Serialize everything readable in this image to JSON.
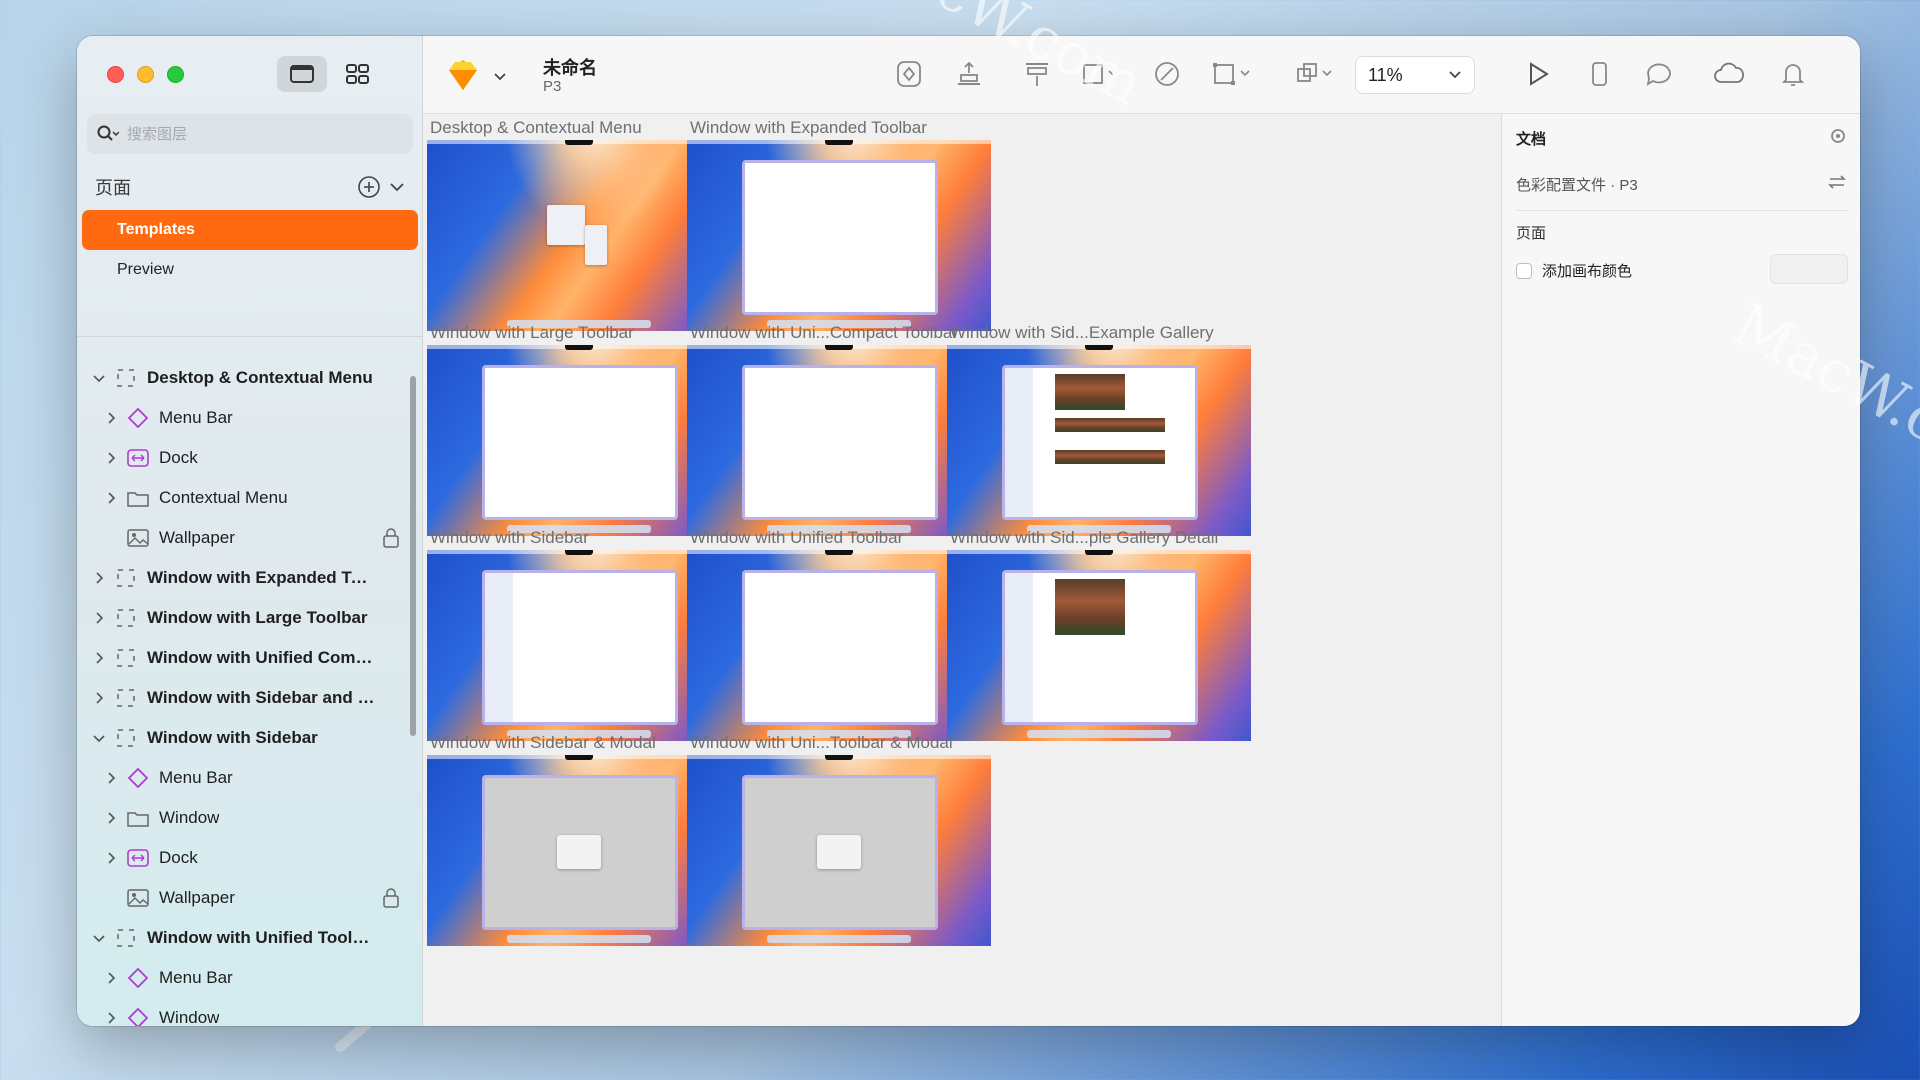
{
  "app": {
    "doc_title": "未命名",
    "doc_subtitle": "P3",
    "zoom": "11%",
    "accent_color": "#ff6a10"
  },
  "sidebar": {
    "search_placeholder": "搜索图层",
    "pages_title": "页面",
    "pages": [
      {
        "label": "Templates",
        "selected": true
      },
      {
        "label": "Preview",
        "selected": false
      }
    ],
    "layers": [
      {
        "label": "Desktop & Contextual Menu",
        "icon": "artboard-icon",
        "expanded": true,
        "level": 0
      },
      {
        "label": "Menu Bar",
        "icon": "symbol-icon",
        "level": 1
      },
      {
        "label": "Dock",
        "icon": "dock-icon",
        "level": 1
      },
      {
        "label": "Contextual Menu",
        "icon": "folder-icon",
        "level": 1
      },
      {
        "label": "Wallpaper",
        "icon": "image-icon",
        "level": 1,
        "locked": true
      },
      {
        "label": "Window with Expanded Tool...",
        "icon": "artboard-icon",
        "level": 0
      },
      {
        "label": "Window with Large Toolbar",
        "icon": "artboard-icon",
        "level": 0
      },
      {
        "label": "Window with Unified Compa...",
        "icon": "artboard-icon",
        "level": 0
      },
      {
        "label": "Window with Sidebar and Ex...",
        "icon": "artboard-icon",
        "level": 0
      },
      {
        "label": "Window with Sidebar",
        "icon": "artboard-icon",
        "expanded": true,
        "level": 0
      },
      {
        "label": "Menu Bar",
        "icon": "symbol-icon",
        "level": 1
      },
      {
        "label": "Window",
        "icon": "folder-icon",
        "level": 1
      },
      {
        "label": "Dock",
        "icon": "dock-icon",
        "level": 1
      },
      {
        "label": "Wallpaper",
        "icon": "image-icon",
        "level": 1,
        "locked": true
      },
      {
        "label": "Window with Unified Toolbar",
        "icon": "artboard-icon",
        "expanded": true,
        "level": 0
      },
      {
        "label": "Menu Bar",
        "icon": "symbol-icon",
        "level": 1
      },
      {
        "label": "Window",
        "icon": "symbol-icon",
        "level": 1
      }
    ]
  },
  "canvas": {
    "artboards": [
      {
        "label": "Desktop & Contextual Menu",
        "kind": "menu"
      },
      {
        "label": "Window with Expanded Toolbar",
        "kind": "window"
      },
      {
        "label": "Window with Large Toolbar",
        "kind": "window"
      },
      {
        "label": "Window with Uni...Compact Toolbar",
        "kind": "window"
      },
      {
        "label": "Window with Sid...Example Gallery",
        "kind": "gallery"
      },
      {
        "label": "Window with Sidebar",
        "kind": "sidebar"
      },
      {
        "label": "Window with Unified Toolbar",
        "kind": "window"
      },
      {
        "label": "Window with Sid...ple Gallery Detail",
        "kind": "detail"
      },
      {
        "label": "Window with Sidebar & Modal",
        "kind": "modal"
      },
      {
        "label": "Window with Uni...Toolbar & Modal",
        "kind": "modal"
      }
    ]
  },
  "inspector": {
    "section_title": "文档",
    "color_profile": "色彩配置文件 · P3",
    "pages_label": "页面",
    "add_canvas_color": "添加画布颜色"
  },
  "watermark": "MacW.com"
}
